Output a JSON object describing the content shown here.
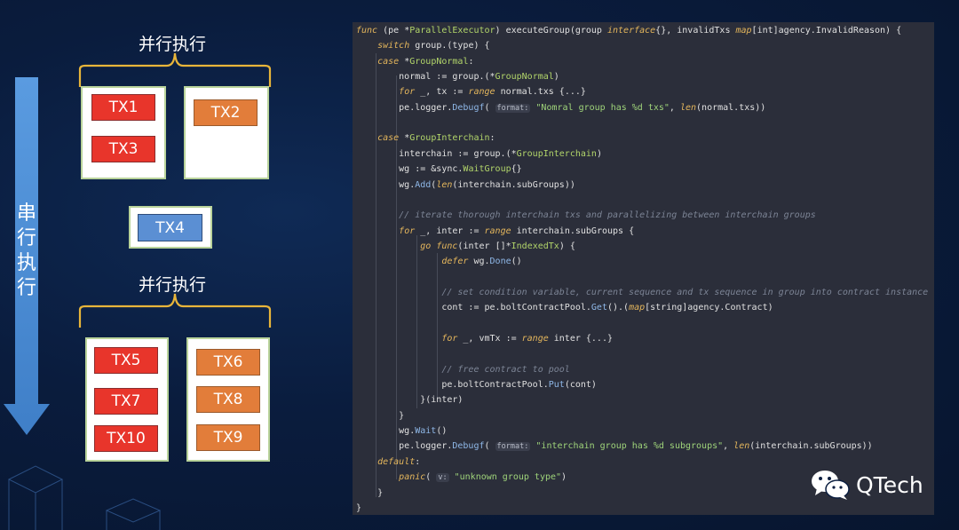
{
  "diagram": {
    "serial_label": [
      "串",
      "行",
      "执",
      "行"
    ],
    "group_top": {
      "title": "并行执行",
      "box_left": [
        "TX1",
        "TX3"
      ],
      "box_right": [
        "TX2"
      ]
    },
    "single": "TX4",
    "group_bottom": {
      "title": "并行执行",
      "box_left": [
        "TX5",
        "TX7",
        "TX10"
      ],
      "box_right": [
        "TX6",
        "TX8",
        "TX9"
      ]
    },
    "colors": {
      "red": "#e8352b",
      "orange": "#e27d3a",
      "blue": "#5b8fd3",
      "arrow": "#4a90d9",
      "brace": "#e8b53a"
    }
  },
  "code": {
    "lines": [
      "func (pe *ParallelExecutor) executeGroup(group interface{}, invalidTxs map[int]agency.InvalidReason) {",
      "    switch group.(type) {",
      "    case *GroupNormal:",
      "        normal := group.(*GroupNormal)",
      "        for _, tx := range normal.txs {...}",
      "        pe.logger.Debugf( format: \"Nomral group has %d txs\", len(normal.txs))",
      "",
      "    case *GroupInterchain:",
      "        interchain := group.(*GroupInterchain)",
      "        wg := &sync.WaitGroup{}",
      "        wg.Add(len(interchain.subGroups))",
      "",
      "        // iterate thorough interchain txs and parallelizing between interchain groups",
      "        for _, inter := range interchain.subGroups {",
      "            go func(inter []*IndexedTx) {",
      "                defer wg.Done()",
      "",
      "                // set condition variable, current sequence and tx sequence in group into contract instance",
      "                cont := pe.boltContractPool.Get().(map[string]agency.Contract)",
      "",
      "                for _, vmTx := range inter {...}",
      "",
      "                // free contract to pool",
      "                pe.boltContractPool.Put(cont)",
      "            }(inter)",
      "        }",
      "        wg.Wait()",
      "        pe.logger.Debugf( format: \"interchain group has %d subgroups\", len(interchain.subGroups))",
      "    default:",
      "        panic( v: \"unknown group type\")",
      "    }",
      "}"
    ]
  },
  "logo": {
    "text": "QTech",
    "icon": "wechat-icon"
  }
}
